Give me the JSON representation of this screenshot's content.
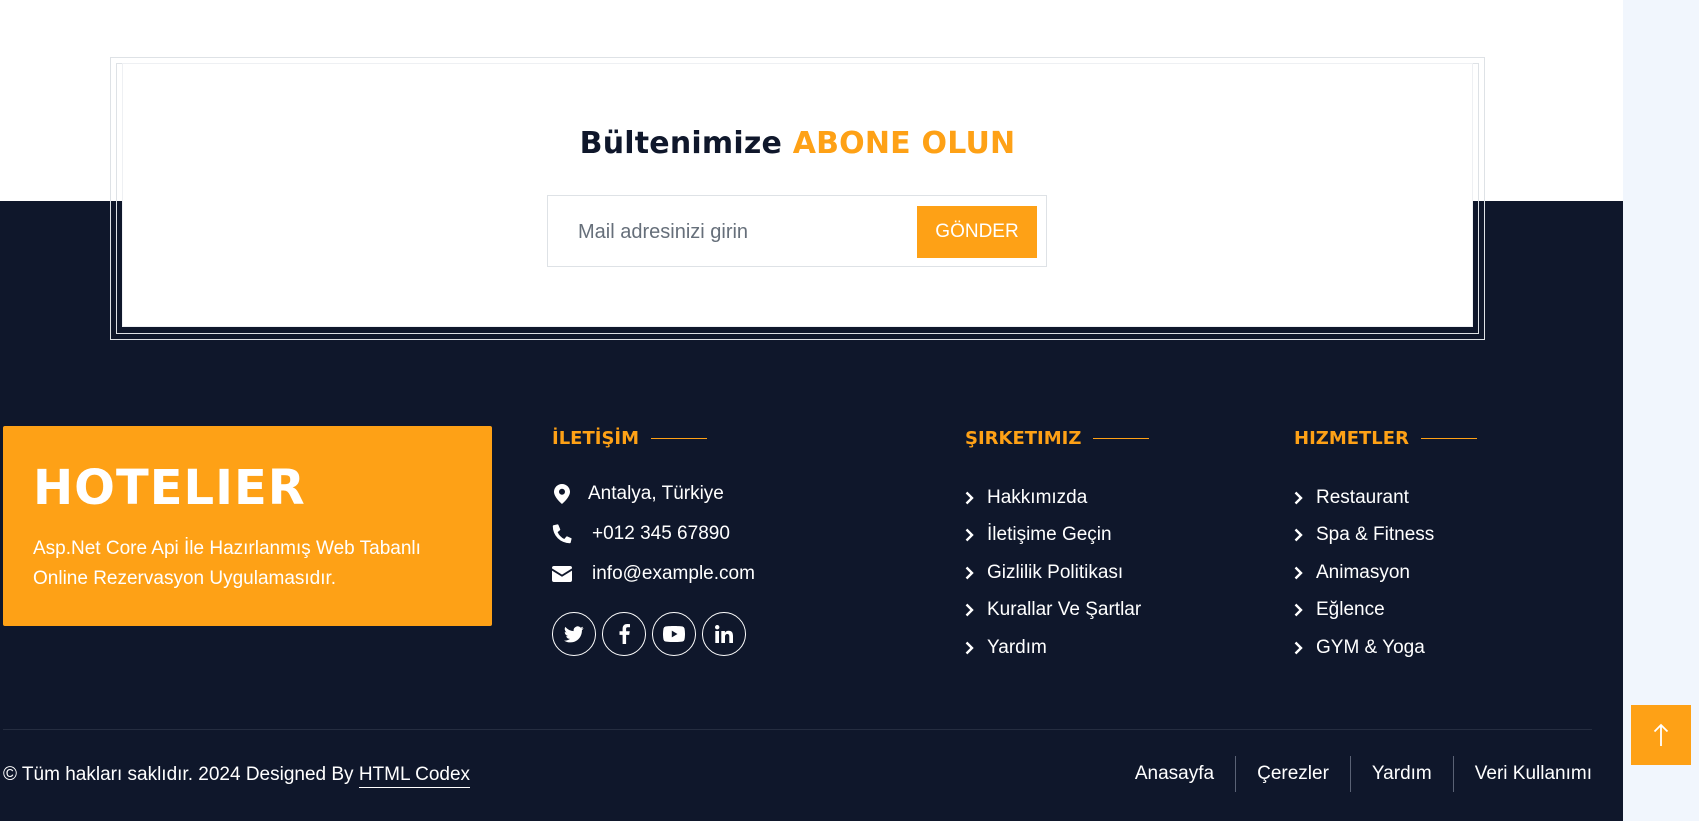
{
  "colors": {
    "accent": "#fea116",
    "dark": "#0f172b",
    "white": "#ffffff"
  },
  "newsletter": {
    "title_main": "Bültenimize",
    "title_accent": "ABONE OLUN",
    "input_placeholder": "Mail adresinizi girin",
    "button_label": "GÖNDER"
  },
  "brand": {
    "name": "HOTELIER",
    "description": "Asp.Net Core Api İle Hazırlanmış Web Tabanlı Online Rezervasyon Uygulamasıdır."
  },
  "contact": {
    "heading": "İLETİŞİM",
    "address": "Antalya, Türkiye",
    "phone": "+012 345 67890",
    "email": "info@example.com",
    "social": [
      {
        "icon": "twitter-icon"
      },
      {
        "icon": "facebook-icon"
      },
      {
        "icon": "youtube-icon"
      },
      {
        "icon": "linkedin-icon"
      }
    ]
  },
  "company": {
    "heading": "ŞIRKETIMIZ",
    "links": [
      "Hakkımızda",
      "İletişime Geçin",
      "Gizlilik Politikası",
      "Kurallar Ve Şartlar",
      "Yardım"
    ]
  },
  "services": {
    "heading": "HIZMETLER",
    "links": [
      "Restaurant",
      "Spa & Fitness",
      "Animasyon",
      "Eğlence",
      "GYM & Yoga"
    ]
  },
  "bottom": {
    "copyright_text": "© Tüm hakları saklıdır. 2024 Designed By",
    "designer_link": "HTML Codex",
    "nav": [
      "Anasayfa",
      "Çerezler",
      "Yardım",
      "Veri Kullanımı"
    ]
  },
  "back_to_top": {
    "icon": "arrow-up-icon"
  }
}
